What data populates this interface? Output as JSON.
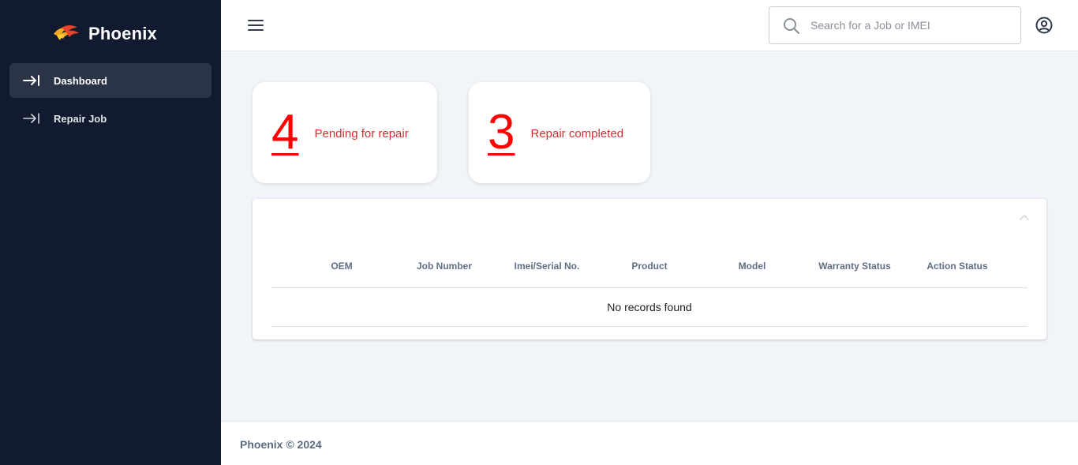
{
  "sidebar": {
    "brand_name": "Phoenix",
    "logo_icon": "phoenix-flame-logo",
    "items": [
      {
        "label": "Dashboard",
        "icon": "arrow-right-to-line-icon",
        "active": true
      },
      {
        "label": "Repair Job",
        "icon": "arrow-right-to-line-icon",
        "active": false
      }
    ]
  },
  "topbar": {
    "menu_icon": "hamburger-menu-icon",
    "search": {
      "placeholder": "Search for a Job or IMEI",
      "value": ""
    },
    "account_icon": "user-circle-icon"
  },
  "stats": [
    {
      "value": "4",
      "label": "Pending for repair"
    },
    {
      "value": "3",
      "label": "Repair completed"
    }
  ],
  "table": {
    "columns": [
      "OEM",
      "Job Number",
      "Imei/Serial No.",
      "Product",
      "Model",
      "Warranty Status",
      "Action Status"
    ],
    "empty_message": "No records found",
    "collapse_icon": "chevron-up-icon"
  },
  "footer": {
    "text": "Phoenix © 2024"
  },
  "colors": {
    "sidebar_bg": "#111a2e",
    "active_item_bg": "#2b3346",
    "stat_number": "#ff0000",
    "stat_label": "#d32f2f",
    "page_bg": "#f1f4f8"
  }
}
